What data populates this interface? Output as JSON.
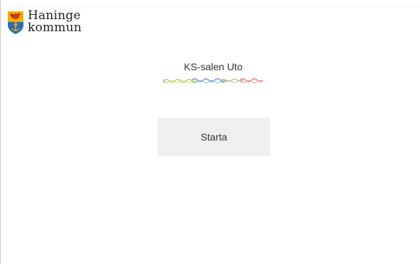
{
  "brand": {
    "line1": "Haninge",
    "line2": "kommun",
    "icon": "coat-of-arms-icon"
  },
  "room": {
    "title": "KS-salen Uto"
  },
  "actions": {
    "start_label": "Starta"
  },
  "colors": {
    "shield_gold": "#f2b000",
    "shield_blue": "#2b6cb0",
    "bird_red": "#d23a1e",
    "button_bg": "#efefef",
    "text": "#333333"
  }
}
